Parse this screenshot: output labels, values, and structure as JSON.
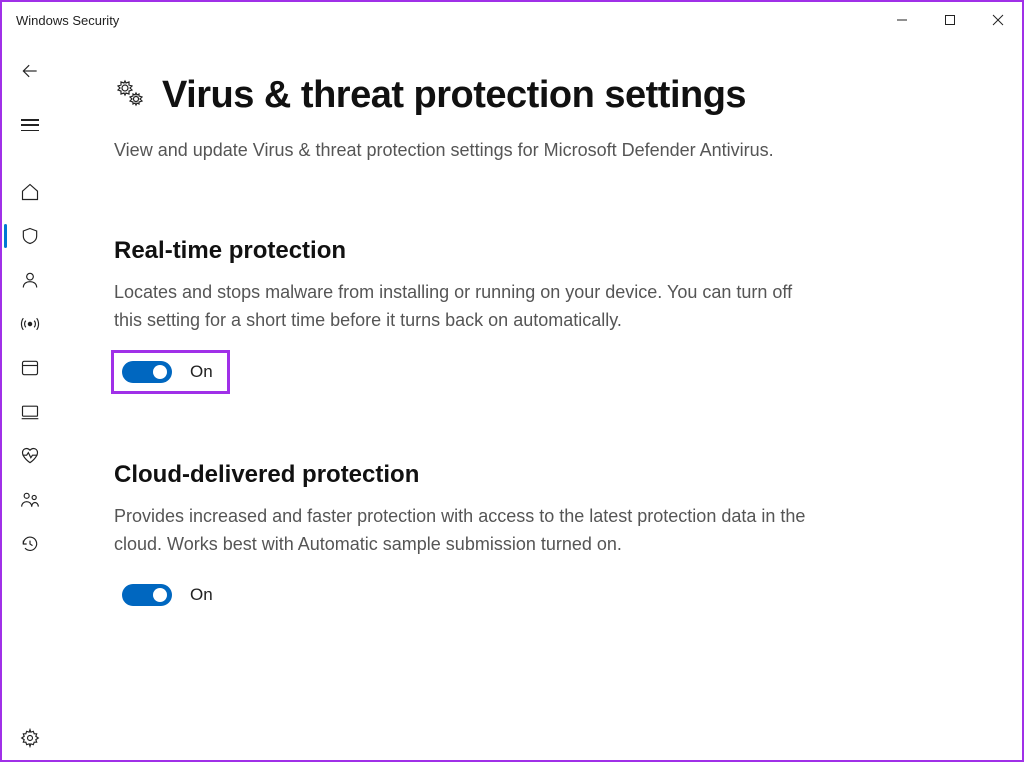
{
  "window": {
    "title": "Windows Security"
  },
  "page": {
    "title": "Virus & threat protection settings",
    "subtitle": "View and update Virus & threat protection settings for Microsoft Defender Antivirus."
  },
  "sections": {
    "realtime": {
      "title": "Real-time protection",
      "desc": "Locates and stops malware from installing or running on your device. You can turn off this setting for a short time before it turns back on automatically.",
      "toggle_label": "On"
    },
    "cloud": {
      "title": "Cloud-delivered protection",
      "desc": "Provides increased and faster protection with access to the latest protection data in the cloud. Works best with Automatic sample submission turned on.",
      "toggle_label": "On"
    }
  }
}
